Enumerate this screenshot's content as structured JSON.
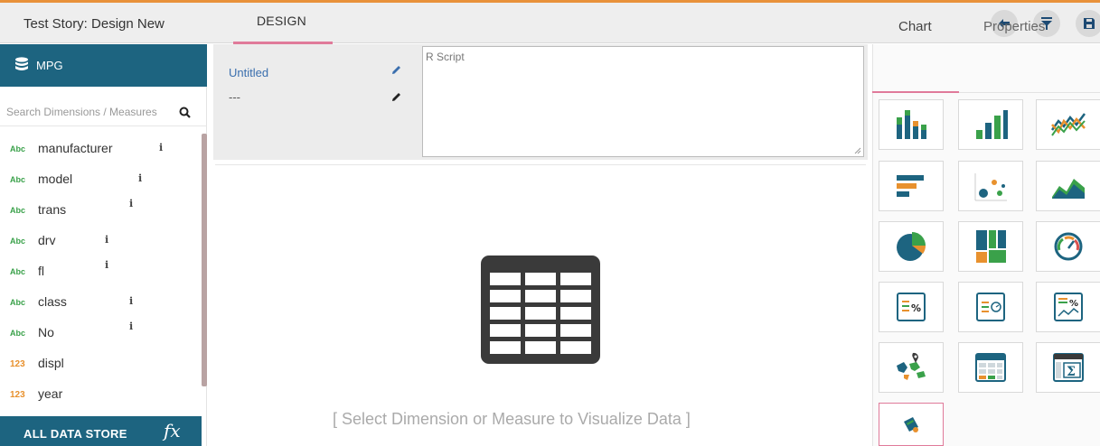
{
  "header": {
    "story_title": "Test Story: Design New",
    "design_tab": "DESIGN",
    "actions": [
      "back-icon",
      "filter-icon",
      "save-icon"
    ]
  },
  "left_panel": {
    "dataset_name": "MPG",
    "search_placeholder": "Search Dimensions / Measures",
    "fields": [
      {
        "type": "Abc",
        "name": "manufacturer",
        "info": "i"
      },
      {
        "type": "Abc",
        "name": "model",
        "info": "i"
      },
      {
        "type": "Abc",
        "name": "trans",
        "info": "i"
      },
      {
        "type": "Abc",
        "name": "drv",
        "info": "i"
      },
      {
        "type": "Abc",
        "name": "fl",
        "info": "i"
      },
      {
        "type": "Abc",
        "name": "class",
        "info": "i"
      },
      {
        "type": "Abc",
        "name": "No",
        "info": "i"
      },
      {
        "type": "123",
        "name": "displ",
        "info": ""
      },
      {
        "type": "123",
        "name": "year",
        "info": ""
      }
    ],
    "footer_label": "ALL DATA STORE",
    "footer_icon": "fx"
  },
  "center": {
    "title": "Untitled",
    "subtitle": "---",
    "script_placeholder": "R Script",
    "empty_message": "[ Select Dimension or Measure to Visualize Data ]"
  },
  "right_panel": {
    "tabs": [
      "Chart",
      "Properties"
    ],
    "active_tab": "Chart",
    "chart_types": [
      "column-chart-icon",
      "bar-chart-icon",
      "line-chart-icon",
      "horizontal-bar-chart-icon",
      "scatter-chart-icon",
      "area-chart-icon",
      "pie-chart-icon",
      "treemap-icon",
      "gauge-icon",
      "kpi-percent-icon",
      "kpi-target-icon",
      "kpi-trend-icon",
      "map-icon",
      "data-grid-icon",
      "pivot-grid-icon",
      "r-script-icon"
    ],
    "selected_chart": "r-script-icon"
  },
  "colors": {
    "accent_orange": "#e8913a",
    "panel_blue": "#1d6480",
    "active_pink": "#e07a9a",
    "dimension_green": "#3aa14a",
    "measure_orange": "#e8912e"
  }
}
